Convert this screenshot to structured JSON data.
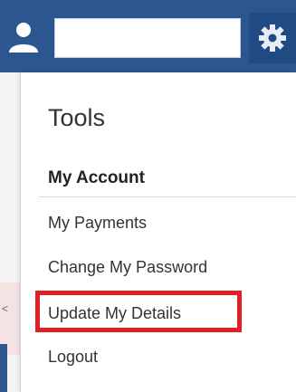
{
  "header": {
    "user_icon": "user-icon",
    "name_field_value": "",
    "settings_icon": "gear-icon",
    "bar_color": "#2c5690"
  },
  "background": {
    "partial_text": "<"
  },
  "menu": {
    "heading": "Tools",
    "section_title": "My Account",
    "items": [
      {
        "label": "My Payments"
      },
      {
        "label": "Change My Password"
      },
      {
        "label": "Update My Details",
        "highlighted": true
      },
      {
        "label": "Logout"
      }
    ],
    "highlight_color": "#e01f26"
  }
}
